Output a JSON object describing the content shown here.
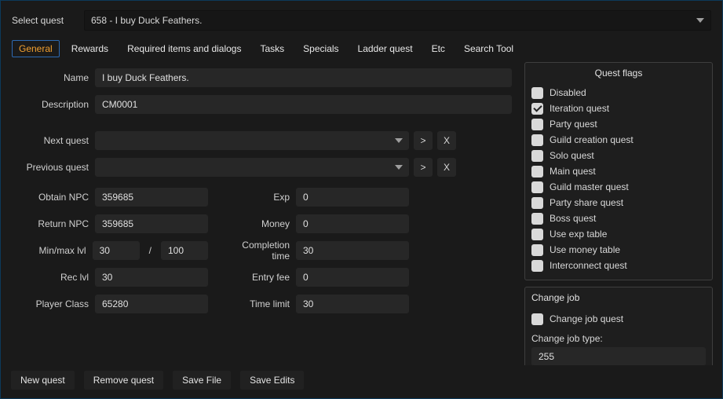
{
  "header": {
    "select_label": "Select quest",
    "selected_quest": "658 - I buy Duck Feathers."
  },
  "tabs": [
    {
      "id": "general",
      "label": "General"
    },
    {
      "id": "rewards",
      "label": "Rewards"
    },
    {
      "id": "req",
      "label": "Required items and dialogs"
    },
    {
      "id": "tasks",
      "label": "Tasks"
    },
    {
      "id": "specials",
      "label": "Specials"
    },
    {
      "id": "ladder",
      "label": "Ladder quest"
    },
    {
      "id": "etc",
      "label": "Etc"
    },
    {
      "id": "search",
      "label": "Search Tool"
    }
  ],
  "fields": {
    "name": {
      "label": "Name",
      "value": "I buy Duck Feathers."
    },
    "description": {
      "label": "Description",
      "value": "CM0001"
    },
    "next_quest": {
      "label": "Next quest",
      "value": "",
      "go": ">",
      "clear": "X"
    },
    "previous_quest": {
      "label": "Previous quest",
      "value": "",
      "go": ">",
      "clear": "X"
    },
    "obtain_npc": {
      "label": "Obtain NPC",
      "value": "359685"
    },
    "return_npc": {
      "label": "Return NPC",
      "value": "359685"
    },
    "min_max_lvl": {
      "label": "Min/max lvl",
      "min": "30",
      "max": "100"
    },
    "rec_lvl": {
      "label": "Rec lvl",
      "value": "30"
    },
    "player_class": {
      "label": "Player Class",
      "value": "65280"
    },
    "exp": {
      "label": "Exp",
      "value": "0"
    },
    "money": {
      "label": "Money",
      "value": "0"
    },
    "completion_time": {
      "label": "Completion time",
      "value": "30"
    },
    "entry_fee": {
      "label": "Entry fee",
      "value": "0"
    },
    "time_limit": {
      "label": "Time limit",
      "value": "30"
    }
  },
  "quest_flags": {
    "title": "Quest flags",
    "items": [
      {
        "id": "disabled",
        "label": "Disabled",
        "checked": false
      },
      {
        "id": "iteration",
        "label": "Iteration quest",
        "checked": true
      },
      {
        "id": "party",
        "label": "Party quest",
        "checked": false
      },
      {
        "id": "guild_creation",
        "label": "Guild creation quest",
        "checked": false
      },
      {
        "id": "solo",
        "label": "Solo quest",
        "checked": false
      },
      {
        "id": "main",
        "label": "Main quest",
        "checked": false
      },
      {
        "id": "guild_master",
        "label": "Guild master quest",
        "checked": false
      },
      {
        "id": "party_share",
        "label": "Party share quest",
        "checked": false
      },
      {
        "id": "boss",
        "label": "Boss quest",
        "checked": false
      },
      {
        "id": "use_exp",
        "label": "Use exp table",
        "checked": false
      },
      {
        "id": "use_money",
        "label": "Use money table",
        "checked": false
      },
      {
        "id": "interconnect",
        "label": "Interconnect quest",
        "checked": false
      }
    ]
  },
  "change_job": {
    "title": "Change job",
    "checkbox": {
      "label": "Change job quest",
      "checked": false
    },
    "type_label": "Change job type:",
    "type_value": "255"
  },
  "footer": {
    "new_quest": "New quest",
    "remove_quest": "Remove quest",
    "save_file": "Save File",
    "save_edits": "Save Edits"
  }
}
